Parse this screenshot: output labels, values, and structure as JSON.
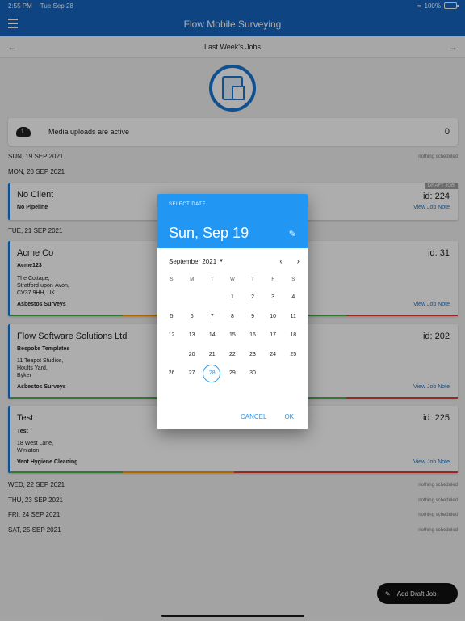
{
  "status": {
    "time": "2:55 PM",
    "date": "Tue Sep 28",
    "battery": "100%"
  },
  "appbar": {
    "title": "Flow Mobile Surveying"
  },
  "subnav": {
    "title": "Last Week's Jobs"
  },
  "uploads": {
    "text": "Media uploads are active",
    "count": "0"
  },
  "days": [
    {
      "label": "SUN, 19 SEP 2021",
      "status": "nothing scheduled"
    },
    {
      "label": "MON, 20 SEP 2021",
      "status": ""
    },
    {
      "label": "TUE, 21 SEP 2021",
      "status": ""
    },
    {
      "label": "WED, 22 SEP 2021",
      "status": "nothing scheduled"
    },
    {
      "label": "THU, 23 SEP 2021",
      "status": "nothing scheduled"
    },
    {
      "label": "FRI, 24 SEP 2021",
      "status": "nothing scheduled"
    },
    {
      "label": "SAT, 25 SEP 2021",
      "status": "nothing scheduled"
    }
  ],
  "jobs": [
    {
      "client": "No Client",
      "id": "id: 224",
      "pipeline": "No Pipeline",
      "address": [],
      "type": "",
      "note": "View Job Note",
      "badge": "DRAFT JOB"
    },
    {
      "client": "Acme Co",
      "id": "id: 31",
      "pipeline": "Acme123",
      "address": [
        "The Cottage,",
        "Stratford-upon-Avon,",
        "CV37 9HH, UK"
      ],
      "type": "Asbestos Surveys",
      "note": "View Job Note",
      "badge": ""
    },
    {
      "client": "Flow Software Solutions Ltd",
      "id": "id: 202",
      "pipeline": "Bespoke Templates",
      "address": [
        "11 Teapot Studios,",
        "Hoults Yard,",
        "Byker"
      ],
      "type": "Asbestos Surveys",
      "note": "View Job Note",
      "badge": ""
    },
    {
      "client": "Test",
      "id": "id: 225",
      "pipeline": "Test",
      "address": [
        "18 West Lane,",
        "Winlaton"
      ],
      "type": "Vent Hygiene Cleaning",
      "note": "View Job Note",
      "badge": ""
    }
  ],
  "picker": {
    "label": "SELECT DATE",
    "selected_date": "Sun, Sep 19",
    "month": "September 2021",
    "weekdays": [
      "S",
      "M",
      "T",
      "W",
      "T",
      "F",
      "S"
    ],
    "weeks": [
      [
        "",
        "",
        "",
        "1",
        "2",
        "3",
        "4"
      ],
      [
        "5",
        "6",
        "7",
        "8",
        "9",
        "10",
        "11"
      ],
      [
        "12",
        "13",
        "14",
        "15",
        "16",
        "17",
        "18"
      ],
      [
        "19",
        "20",
        "21",
        "22",
        "23",
        "24",
        "25"
      ],
      [
        "26",
        "27",
        "28",
        "29",
        "30",
        "",
        ""
      ]
    ],
    "selected_day": "19",
    "today": "28",
    "cancel": "CANCEL",
    "ok": "OK"
  },
  "fab": {
    "label": "Add Draft Job"
  },
  "colors": {
    "primary": "#1565c0",
    "accent": "#2196f3",
    "bar_green": "#4caf50",
    "bar_orange": "#ff9800",
    "bar_red": "#e53935"
  }
}
